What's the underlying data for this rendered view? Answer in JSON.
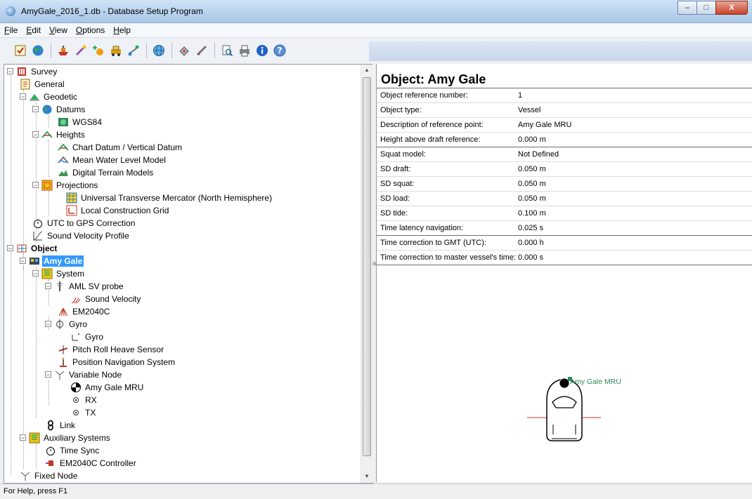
{
  "window": {
    "title": "AmyGale_2016_1.db - Database Setup Program",
    "controls": [
      "–",
      "□",
      "X"
    ]
  },
  "menu": {
    "items": [
      "File",
      "Edit",
      "View",
      "Options",
      "Help"
    ]
  },
  "toolbar": {
    "icons": [
      "checklist-icon",
      "globe-icon",
      "ship-icon",
      "wand-icon",
      "add-node-icon",
      "vehicle-icon",
      "link-icon",
      "globe-grid-icon",
      "satellite-icon",
      "sensor-icon",
      "print-preview-icon",
      "printer-icon",
      "info-icon",
      "help-icon"
    ]
  },
  "tree": {
    "nodes": [
      {
        "label": "Survey"
      },
      {
        "label": "General"
      },
      {
        "label": "Geodetic"
      },
      {
        "label": "Datums"
      },
      {
        "label": "WGS84"
      },
      {
        "label": "Heights"
      },
      {
        "label": "Chart Datum / Vertical Datum"
      },
      {
        "label": "Mean Water Level Model"
      },
      {
        "label": "Digital Terrain Models"
      },
      {
        "label": "Projections"
      },
      {
        "label": "Universal Transverse Mercator (North Hemisphere)"
      },
      {
        "label": "Local Construction Grid"
      },
      {
        "label": "UTC to GPS Correction"
      },
      {
        "label": "Sound Velocity Profile"
      },
      {
        "label": "Object"
      },
      {
        "label": "Amy Gale"
      },
      {
        "label": "System"
      },
      {
        "label": "AML SV probe"
      },
      {
        "label": "Sound Velocity"
      },
      {
        "label": "EM2040C"
      },
      {
        "label": "Gyro"
      },
      {
        "label": "Gyro"
      },
      {
        "label": "Pitch Roll Heave Sensor"
      },
      {
        "label": "Position Navigation System"
      },
      {
        "label": "Variable Node"
      },
      {
        "label": "Amy Gale MRU"
      },
      {
        "label": "RX"
      },
      {
        "label": "TX"
      },
      {
        "label": "Link"
      },
      {
        "label": "Auxiliary Systems"
      },
      {
        "label": "Time Sync"
      },
      {
        "label": "EM2040C Controller"
      },
      {
        "label": "Fixed Node"
      }
    ]
  },
  "properties": {
    "title": "Object: Amy Gale",
    "rows": [
      {
        "key": "Object reference number:",
        "value": "1"
      },
      {
        "key": "Object type:",
        "value": "Vessel"
      },
      {
        "key": "Description of reference point:",
        "value": "Amy Gale MRU"
      },
      {
        "key": "Height above draft reference:",
        "value": "0.000 m"
      },
      {
        "key": "Squat model:",
        "value": "Not Defined"
      },
      {
        "key": "SD draft:",
        "value": "0.050 m"
      },
      {
        "key": "SD squat:",
        "value": "0.050 m"
      },
      {
        "key": "SD load:",
        "value": "0.050 m"
      },
      {
        "key": "SD tide:",
        "value": "0.100 m"
      },
      {
        "key": "Time latency navigation:",
        "value": "0.025 s"
      },
      {
        "key": "Time correction to GMT (UTC):",
        "value": "0.000 h"
      },
      {
        "key": "Time correction to master vessel's time:",
        "value": "0.000 s"
      }
    ]
  },
  "vessel_view": {
    "reference_label": "Amy Gale MRU"
  },
  "status": {
    "text": "For Help, press F1"
  },
  "colors": {
    "selection": "#3399ff",
    "reference_label": "#2e8b57",
    "axis_line": "#e0302a"
  }
}
